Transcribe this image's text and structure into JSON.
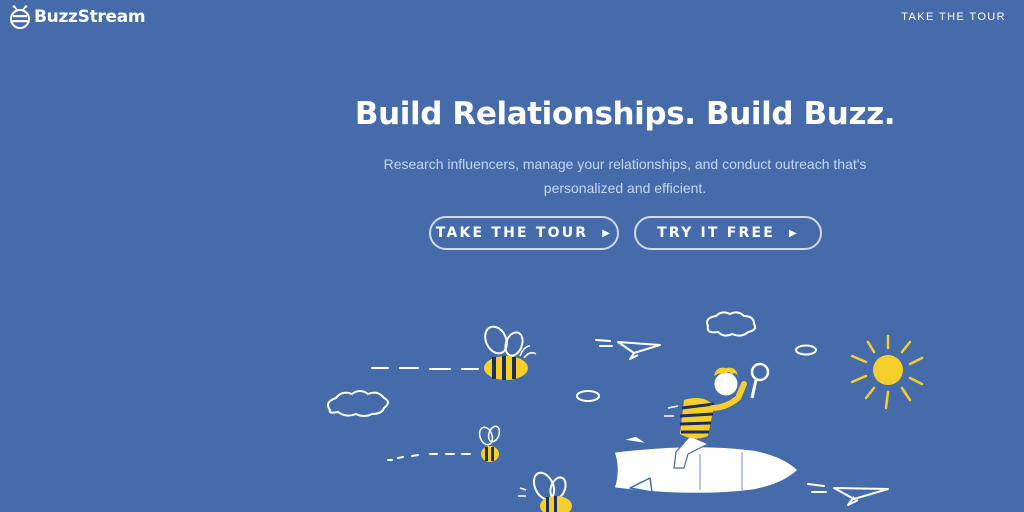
{
  "header": {
    "logo_text": "BuzzStream",
    "nav_link": "TAKE THE TOUR"
  },
  "hero": {
    "title": "Build Relationships. Build Buzz.",
    "subtitle_line1": "Research influencers, manage your relationships, and conduct outreach that's",
    "subtitle_line2": "personalized and efficient."
  },
  "buttons": {
    "tour_label": "TAKE THE TOUR",
    "free_label": "TRY IT FREE",
    "arrow_glyph": "▶"
  },
  "colors": {
    "background": "#456bab",
    "text": "#ffffff",
    "subtitle": "#c6d6ee",
    "accent_yellow": "#f7cf2c",
    "stripe_dark": "#1e2e55"
  }
}
